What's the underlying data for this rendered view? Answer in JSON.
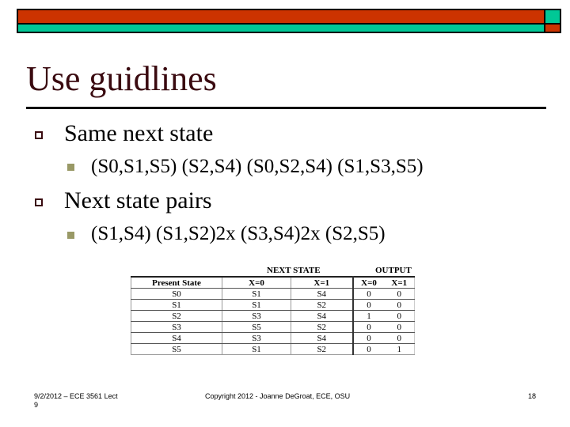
{
  "colors": {
    "header_red": "#cc3300",
    "header_teal": "#00c896",
    "title_color": "#3a0a10",
    "level1_bullet_border": "#3a0a10",
    "level2_bullet_fill": "#999966"
  },
  "slide": {
    "title": "Use guidlines",
    "bullets": [
      {
        "icon": "hollow-square-bullet",
        "text": "Same next state",
        "sub": [
          {
            "icon": "filled-square-bullet",
            "text": "(S0,S1,S5) (S2,S4) (S0,S2,S4) (S1,S3,S5)"
          }
        ]
      },
      {
        "icon": "hollow-square-bullet",
        "text": "Next state pairs",
        "sub": [
          {
            "icon": "filled-square-bullet",
            "text": "(S1,S4) (S1,S2)2x (S3,S4)2x (S2,S5)"
          }
        ]
      }
    ]
  },
  "table": {
    "group_headers": {
      "next_state": "NEXT STATE",
      "output": "OUTPUT"
    },
    "columns": [
      "Present State",
      "X=0",
      "X=1",
      "X=0",
      "X=1"
    ],
    "rows": [
      [
        "S0",
        "S1",
        "S4",
        "0",
        "0"
      ],
      [
        "S1",
        "S1",
        "S2",
        "0",
        "0"
      ],
      [
        "S2",
        "S3",
        "S4",
        "1",
        "0"
      ],
      [
        "S3",
        "S5",
        "S2",
        "0",
        "0"
      ],
      [
        "S4",
        "S3",
        "S4",
        "0",
        "0"
      ],
      [
        "S5",
        "S1",
        "S2",
        "0",
        "1"
      ]
    ]
  },
  "footer": {
    "left": "9/2/2012 – ECE 3561 Lect",
    "left_line2": "9",
    "center": "Copyright 2012 -  Joanne DeGroat, ECE, OSU",
    "page_number": "18"
  }
}
